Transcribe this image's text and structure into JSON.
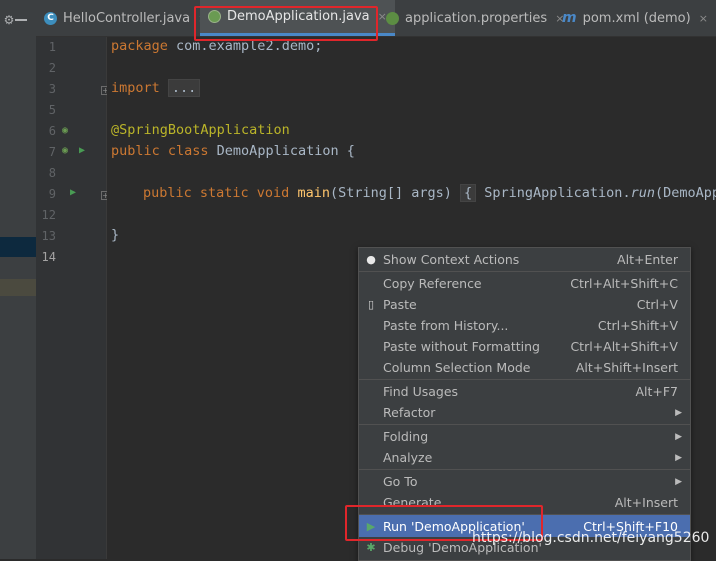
{
  "tabs": [
    {
      "label": "HelloController.java",
      "icon": "class-icon",
      "icon_letter": "C",
      "close": "×"
    },
    {
      "label": "DemoApplication.java",
      "icon": "spring-class-icon",
      "close": "×"
    },
    {
      "label": "application.properties",
      "icon": "spring-properties-icon",
      "close": "×"
    },
    {
      "label": "pom.xml (demo)",
      "icon": "maven-icon",
      "icon_letter": "m",
      "close": "×"
    }
  ],
  "line_numbers": [
    "1",
    "2",
    "3",
    "5",
    "6",
    "7",
    "8",
    "9",
    "12",
    "13",
    "14"
  ],
  "code": {
    "line1_kw": "package",
    "line1_rest": " com.example2.demo;",
    "line3_kw": "import",
    "line3_folded": "...",
    "line6": "@SpringBootApplication",
    "line7_kw": "public class",
    "line7_rest": " DemoApplication {",
    "line9_kw": "public static void",
    "line9_fn": " main",
    "line9_args": "(String[] args) ",
    "line9_fold_open": "{",
    "line9_call": " SpringApplication.",
    "line9_run": "run",
    "line9_tail": "(DemoAppli",
    "line13": "}"
  },
  "context_menu": {
    "items": [
      {
        "label": "Show Context Actions",
        "shortcut": "Alt+Enter",
        "icon": "lightbulb-icon"
      },
      {
        "label": "Copy Reference",
        "shortcut": "Ctrl+Alt+Shift+C"
      },
      {
        "label": "Paste",
        "shortcut": "Ctrl+V",
        "icon": "clipboard-icon"
      },
      {
        "label": "Paste from History...",
        "shortcut": "Ctrl+Shift+V"
      },
      {
        "label": "Paste without Formatting",
        "shortcut": "Ctrl+Alt+Shift+V"
      },
      {
        "label": "Column Selection Mode",
        "shortcut": "Alt+Shift+Insert"
      },
      {
        "label": "Find Usages",
        "shortcut": "Alt+F7"
      },
      {
        "label": "Refactor",
        "submenu": true
      },
      {
        "label": "Folding",
        "submenu": true
      },
      {
        "label": "Analyze",
        "submenu": true
      },
      {
        "label": "Go To",
        "submenu": true
      },
      {
        "label": "Generate...",
        "shortcut": "Alt+Insert"
      },
      {
        "label": "Run 'DemoApplication'",
        "shortcut": "Ctrl+Shift+F10",
        "icon": "run-icon",
        "highlighted": true
      },
      {
        "label": "Debug 'DemoApplication'",
        "shortcut": "",
        "icon": "debug-icon"
      }
    ]
  },
  "watermark": "https://blog.csdn.net/feiyang5260",
  "colors": {
    "editor_bg": "#2b2b2b",
    "highlight": "#4b6eaf",
    "annotation_red": "#e0262b",
    "keyword": "#cc7832",
    "annotation": "#bbb529",
    "function": "#ffc66d"
  }
}
